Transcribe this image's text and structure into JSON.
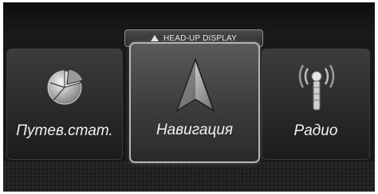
{
  "hud_tab": {
    "label": "HEAD-UP DISPLAY",
    "icon": "up-triangle-icon"
  },
  "menu": {
    "items": [
      {
        "label": "Путев.стат.",
        "icon": "pie-chart-icon",
        "selected": false
      },
      {
        "label": "Навигация",
        "icon": "navigation-arrow-icon",
        "selected": true
      },
      {
        "label": "Радио",
        "icon": "radio-antenna-icon",
        "selected": false
      }
    ]
  }
}
